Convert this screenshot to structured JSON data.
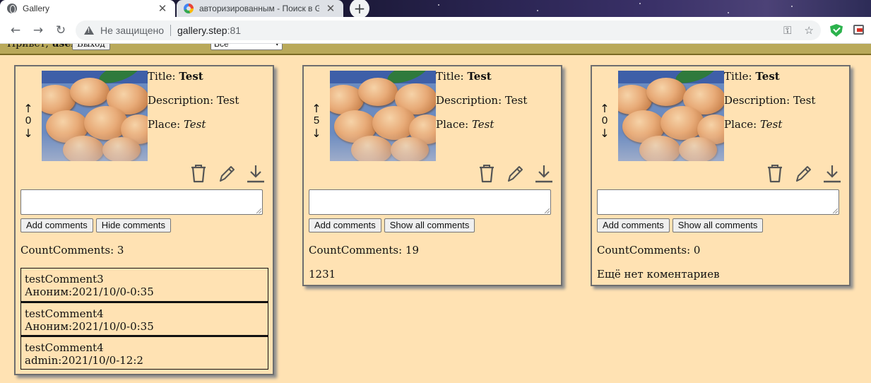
{
  "browser": {
    "tabs": [
      {
        "title": "Gallery",
        "active": true,
        "icon": "globe-icon"
      },
      {
        "title": "авторизированным - Поиск в Google",
        "active": false,
        "icon": "google-icon"
      }
    ],
    "address": {
      "security_label": "Не защищено",
      "host": "gallery.step",
      "port": ":81"
    }
  },
  "header": {
    "greeting": "Привет,",
    "username": "user",
    "logout_label": "Выход",
    "filter_selected": "Все"
  },
  "cards": [
    {
      "votes": "0",
      "title_label": "Title:",
      "title": "Test",
      "description_label": "Description:",
      "description": "Test",
      "place_label": "Place:",
      "place": "Test",
      "add_comments_label": "Add comments",
      "toggle_comments_label": "Hide comments",
      "count_label": "CountComments:",
      "count": "3",
      "comments": [
        {
          "text": "testComment3",
          "author_line": "Аноним:2021/10/0-0:35"
        },
        {
          "text": "testComment4",
          "author_line": "Аноним:2021/10/0-0:35"
        },
        {
          "text": "testComment4",
          "author_line": "admin:2021/10/0-12:2"
        }
      ]
    },
    {
      "votes": "5",
      "title_label": "Title:",
      "title": "Test",
      "description_label": "Description:",
      "description": "Test",
      "place_label": "Place:",
      "place": "Test",
      "add_comments_label": "Add comments",
      "toggle_comments_label": "Show all comments",
      "count_label": "CountComments:",
      "count": "19",
      "extra_text": "1231"
    },
    {
      "votes": "0",
      "title_label": "Title:",
      "title": "Test",
      "description_label": "Description:",
      "description": "Test",
      "place_label": "Place:",
      "place": "Test",
      "add_comments_label": "Add comments",
      "toggle_comments_label": "Show all comments",
      "count_label": "CountComments:",
      "count": "0",
      "extra_text": "Ещё нет коментариев"
    }
  ],
  "icons": {
    "vote_up": "↑",
    "vote_down": "↓",
    "delete": "trash-icon",
    "edit": "pencil-icon",
    "download": "download-icon"
  },
  "colors": {
    "page_background": "#ffe2b3",
    "header_bar": "#b9a95a"
  }
}
